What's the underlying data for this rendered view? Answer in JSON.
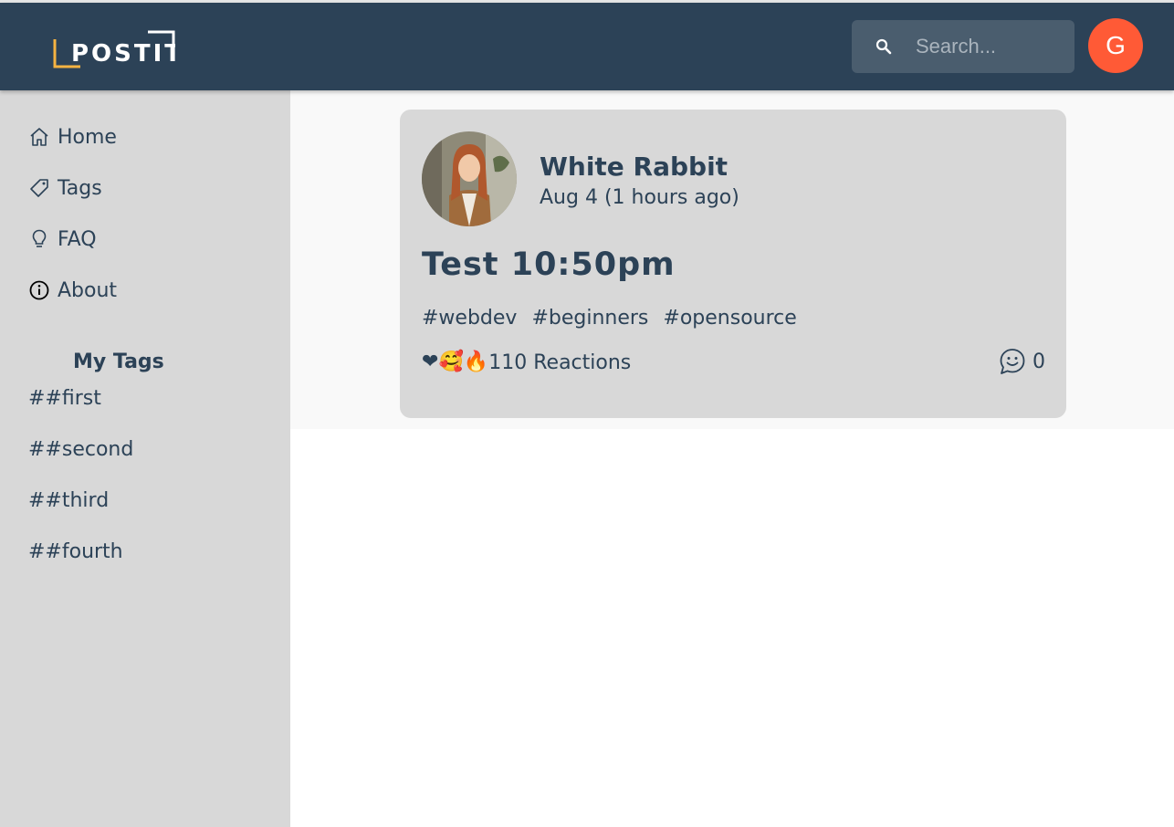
{
  "header": {
    "logo_text": "POSTIT",
    "search_placeholder": "Search...",
    "user_initial": "G",
    "user_color": "#ff5a36",
    "accent_color": "#f5b342"
  },
  "sidebar": {
    "nav": [
      {
        "label": "Home",
        "icon": "home-icon"
      },
      {
        "label": "Tags",
        "icon": "tag-icon"
      },
      {
        "label": "FAQ",
        "icon": "lightbulb-icon"
      },
      {
        "label": "About",
        "icon": "info-icon"
      }
    ],
    "my_tags_title": "My Tags",
    "my_tags": [
      "##first",
      "##second",
      "##third",
      "##fourth"
    ]
  },
  "post": {
    "author": "White Rabbit",
    "date": "Aug 4 (1 hours ago)",
    "title": "Test 10:50pm",
    "tags": [
      "#webdev",
      "#beginners",
      "#opensource"
    ],
    "reactions_label": "110 Reactions",
    "reaction_emojis": [
      "❤",
      "🥰",
      "🔥"
    ],
    "comments_count": "0"
  }
}
